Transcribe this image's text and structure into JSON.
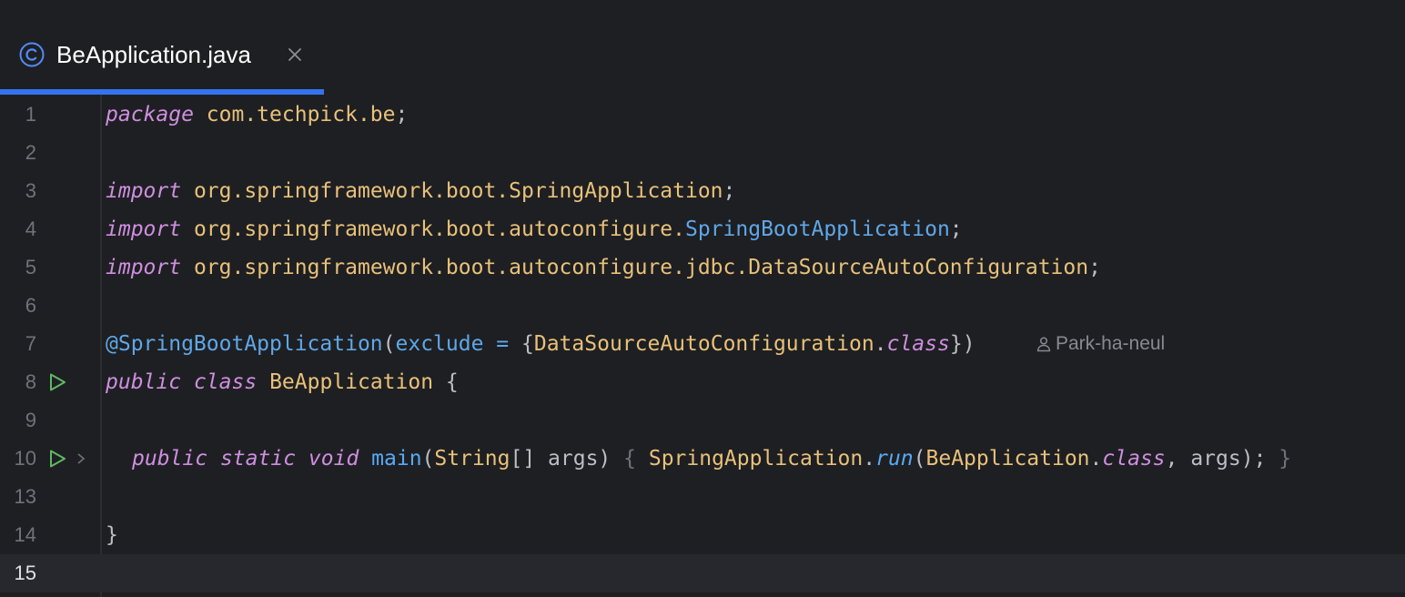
{
  "tab": {
    "title": "BeApplication.java",
    "icon": "java-class-icon",
    "close_icon": "close-icon",
    "accent": "#3574f0"
  },
  "editor": {
    "lines": [
      {
        "number": "1",
        "tokens": [
          [
            "kw",
            "package"
          ],
          [
            "pl",
            " "
          ],
          [
            "ident",
            "com.techpick.be"
          ],
          [
            "pl",
            ";"
          ]
        ]
      },
      {
        "number": "2",
        "tokens": []
      },
      {
        "number": "3",
        "tokens": [
          [
            "kw",
            "import"
          ],
          [
            "pl",
            " "
          ],
          [
            "ident",
            "org.springframework.boot.SpringApplication"
          ],
          [
            "pl",
            ";"
          ]
        ]
      },
      {
        "number": "4",
        "tokens": [
          [
            "kw",
            "import"
          ],
          [
            "pl",
            " "
          ],
          [
            "ident",
            "org.springframework.boot.autoconfigure."
          ],
          [
            "ann",
            "SpringBootApplication"
          ],
          [
            "pl",
            ";"
          ]
        ]
      },
      {
        "number": "5",
        "tokens": [
          [
            "kw",
            "import"
          ],
          [
            "pl",
            " "
          ],
          [
            "ident",
            "org.springframework.boot.autoconfigure.jdbc.DataSourceAutoConfiguration"
          ],
          [
            "pl",
            ";"
          ]
        ]
      },
      {
        "number": "6",
        "tokens": []
      },
      {
        "number": "7",
        "tokens": [
          [
            "ann",
            "@SpringBootApplication"
          ],
          [
            "pl",
            "("
          ],
          [
            "attr",
            "exclude"
          ],
          [
            "pl",
            " "
          ],
          [
            "attr",
            "="
          ],
          [
            "pl",
            " {"
          ],
          [
            "ident",
            "DataSourceAutoConfiguration"
          ],
          [
            "pl",
            "."
          ],
          [
            "kw",
            "class"
          ],
          [
            "pl",
            "})"
          ]
        ],
        "blame": "Park-ha-neul"
      },
      {
        "number": "8",
        "tokens": [
          [
            "kw",
            "public"
          ],
          [
            "pl",
            " "
          ],
          [
            "kw",
            "class"
          ],
          [
            "pl",
            " "
          ],
          [
            "ident",
            "BeApplication"
          ],
          [
            "pl",
            " {"
          ]
        ],
        "run": true
      },
      {
        "number": "9",
        "tokens": []
      },
      {
        "number": "10",
        "tokens": [
          [
            "kw",
            "public"
          ],
          [
            "pl",
            " "
          ],
          [
            "kw",
            "static"
          ],
          [
            "pl",
            " "
          ],
          [
            "kw",
            "void"
          ],
          [
            "pl",
            " "
          ],
          [
            "fn",
            "main"
          ],
          [
            "pl",
            "("
          ],
          [
            "ident",
            "String"
          ],
          [
            "pl",
            "[] args) "
          ],
          [
            "brace-dim",
            "{"
          ],
          [
            "pl",
            " "
          ],
          [
            "ident",
            "SpringApplication"
          ],
          [
            "pl",
            "."
          ],
          [
            "run",
            "run"
          ],
          [
            "pl",
            "("
          ],
          [
            "ident",
            "BeApplication"
          ],
          [
            "pl",
            "."
          ],
          [
            "kw",
            "class"
          ],
          [
            "pl",
            ", args); "
          ],
          [
            "brace-dim",
            "}"
          ]
        ],
        "run": true,
        "fold": true,
        "indent": true
      },
      {
        "number": "13",
        "tokens": []
      },
      {
        "number": "14",
        "tokens": [
          [
            "pl",
            "}"
          ]
        ]
      },
      {
        "number": "15",
        "tokens": [],
        "current": true
      }
    ]
  },
  "colors": {
    "background": "#1e1f22",
    "keyword": "#cf8ee1",
    "identifier": "#e8c17a",
    "annotation": "#5fa7e8",
    "run_icon": "#5fb865"
  }
}
